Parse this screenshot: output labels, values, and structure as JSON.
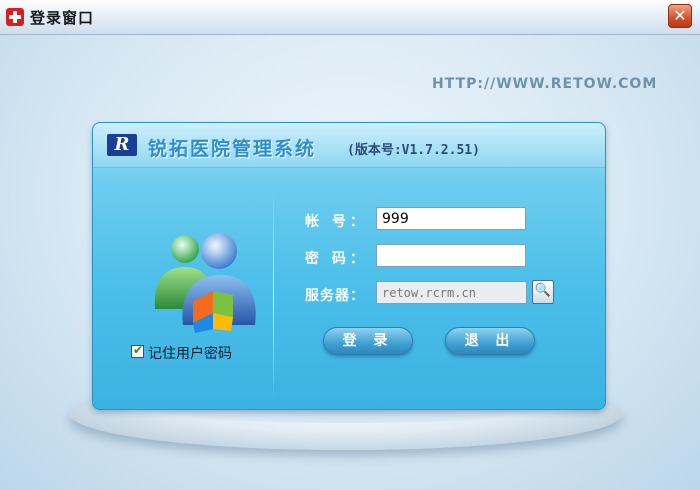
{
  "window": {
    "title": "登录窗口",
    "close_symbol": "✕",
    "icon": "red-cross-icon"
  },
  "branding": {
    "url": "HTTP://WWW.RETOW.COM",
    "logo_letter": "R",
    "system_name": "锐拓医院管理系统",
    "version": "(版本号:V1.7.2.51)"
  },
  "form": {
    "account_label": "帐  号：",
    "account_value": "999",
    "password_label": "密  码：",
    "password_value": "",
    "server_label": "服务器：",
    "server_value": "retow.rcrm.cn",
    "browse_symbol": "🔍",
    "remember_label": "记住用户密码",
    "remember_checked": true,
    "login_label": "登 录",
    "exit_label": "退 出"
  },
  "colors": {
    "panel": "#4cbfea",
    "system_name": "#2a8fd0",
    "close_button": "#d2512c",
    "title_icon": "#d81e1e"
  }
}
